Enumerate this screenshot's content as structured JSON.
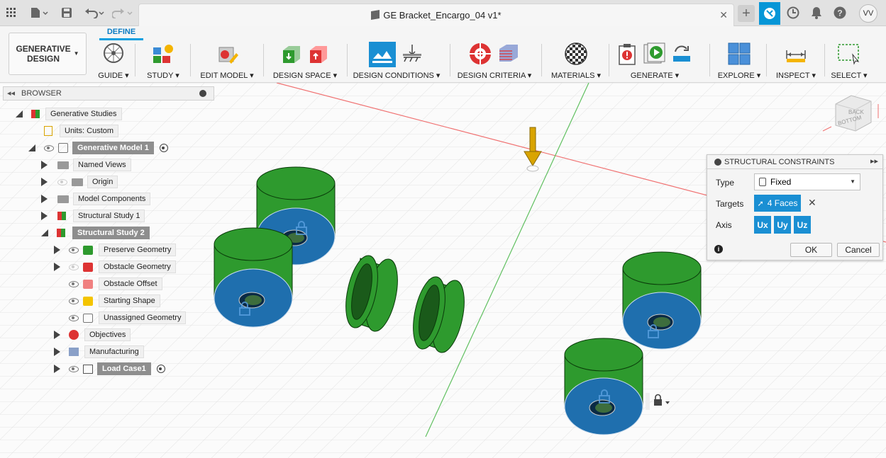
{
  "titlebar": {
    "document_title": "GE Bracket_Encargo_04 v1*",
    "user_initials": "VV"
  },
  "workspace": {
    "label_line1": "GENERATIVE",
    "label_line2": "DESIGN",
    "active_tab": "DEFINE"
  },
  "toolbar": {
    "groups": [
      {
        "label": "GUIDE ▾",
        "icon": "compass-icon"
      },
      {
        "label": "STUDY ▾",
        "icon": "study-icon"
      },
      {
        "label": "EDIT MODEL ▾",
        "icon": "edit-model-icon"
      },
      {
        "label": "DESIGN SPACE ▾",
        "icon": "design-space-icon"
      },
      {
        "label": "DESIGN CONDITIONS ▾",
        "icon": "design-conditions-icon"
      },
      {
        "label": "DESIGN CRITERIA ▾",
        "icon": "design-criteria-icon"
      },
      {
        "label": "MATERIALS ▾",
        "icon": "materials-icon"
      },
      {
        "label": "GENERATE ▾",
        "icon": "generate-icon"
      },
      {
        "label": "EXPLORE ▾",
        "icon": "explore-icon"
      },
      {
        "label": "INSPECT ▾",
        "icon": "measure-icon"
      },
      {
        "label": "SELECT ▾",
        "icon": "select-box-icon"
      }
    ]
  },
  "browser": {
    "title": "BROWSER",
    "items": [
      {
        "label": "Generative Studies"
      },
      {
        "label": "Units: Custom"
      },
      {
        "label": "Generative Model 1"
      },
      {
        "label": "Named Views"
      },
      {
        "label": "Origin"
      },
      {
        "label": "Model Components"
      },
      {
        "label": "Structural Study 1"
      },
      {
        "label": "Structural Study 2"
      },
      {
        "label": "Preserve Geometry"
      },
      {
        "label": "Obstacle Geometry"
      },
      {
        "label": "Obstacle Offset"
      },
      {
        "label": "Starting Shape"
      },
      {
        "label": "Unassigned Geometry"
      },
      {
        "label": "Objectives"
      },
      {
        "label": "Manufacturing"
      },
      {
        "label": "Load Case1"
      }
    ]
  },
  "viewcube": {
    "back": "BACK",
    "bottom": "BOTTOM"
  },
  "dialog": {
    "title": "STRUCTURAL CONSTRAINTS",
    "type_label": "Type",
    "type_value": "Fixed",
    "targets_label": "Targets",
    "targets_value": "4 Faces",
    "axis_label": "Axis",
    "axis_ux": "Ux",
    "axis_uy": "Uy",
    "axis_uz": "Uz",
    "ok_label": "OK",
    "cancel_label": "Cancel"
  },
  "colors": {
    "accent_blue": "#1a8fd3",
    "cylinder_green": "#2e9a2e",
    "face_blue": "#1f6fae",
    "load_arrow": "#d9a400"
  }
}
